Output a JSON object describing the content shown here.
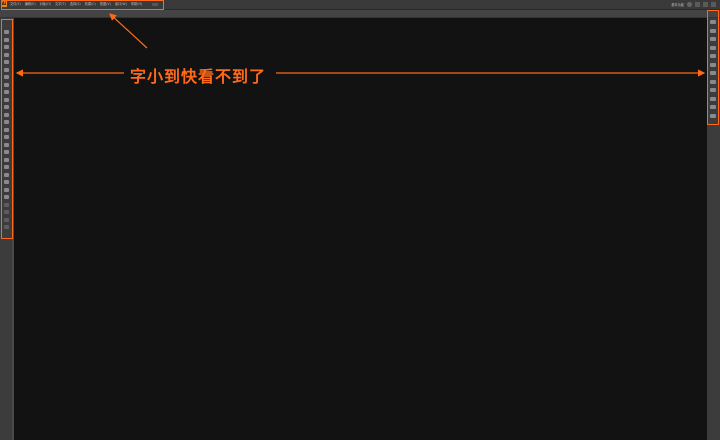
{
  "menubar": {
    "logo": "Ai",
    "items": [
      "文件(F)",
      "编辑(E)",
      "对象(O)",
      "文字(T)",
      "选择(S)",
      "效果(C)",
      "视图(V)",
      "窗口(W)",
      "帮助(H)"
    ],
    "workspace_label": "基本功能"
  },
  "annotation": {
    "text": "字小到快看不到了",
    "color": "#ff6a1a"
  },
  "colors": {
    "canvas": "#121212",
    "panel": "#3c3c3c",
    "highlight": "#ff6a1a"
  },
  "icons": {
    "left_tools": [
      "selection-tool-icon",
      "direct-selection-tool-icon",
      "magic-wand-icon",
      "lasso-icon",
      "pen-tool-icon",
      "type-tool-icon",
      "line-tool-icon",
      "rectangle-tool-icon",
      "paintbrush-icon",
      "pencil-icon",
      "eraser-icon",
      "rotate-icon",
      "scale-icon",
      "warp-icon",
      "free-transform-icon",
      "shape-builder-icon",
      "perspective-grid-icon",
      "mesh-icon",
      "gradient-icon",
      "eyedropper-icon",
      "blend-icon",
      "symbol-sprayer-icon",
      "graph-icon",
      "artboard-icon",
      "slice-icon",
      "hand-icon",
      "zoom-icon"
    ],
    "right_panels": [
      "color-panel-icon",
      "swatches-panel-icon",
      "brushes-panel-icon",
      "symbols-panel-icon",
      "stroke-panel-icon",
      "gradient-panel-icon",
      "transparency-panel-icon",
      "appearance-panel-icon",
      "graphic-styles-panel-icon",
      "layers-panel-icon",
      "artboards-panel-icon",
      "links-panel-icon"
    ]
  }
}
